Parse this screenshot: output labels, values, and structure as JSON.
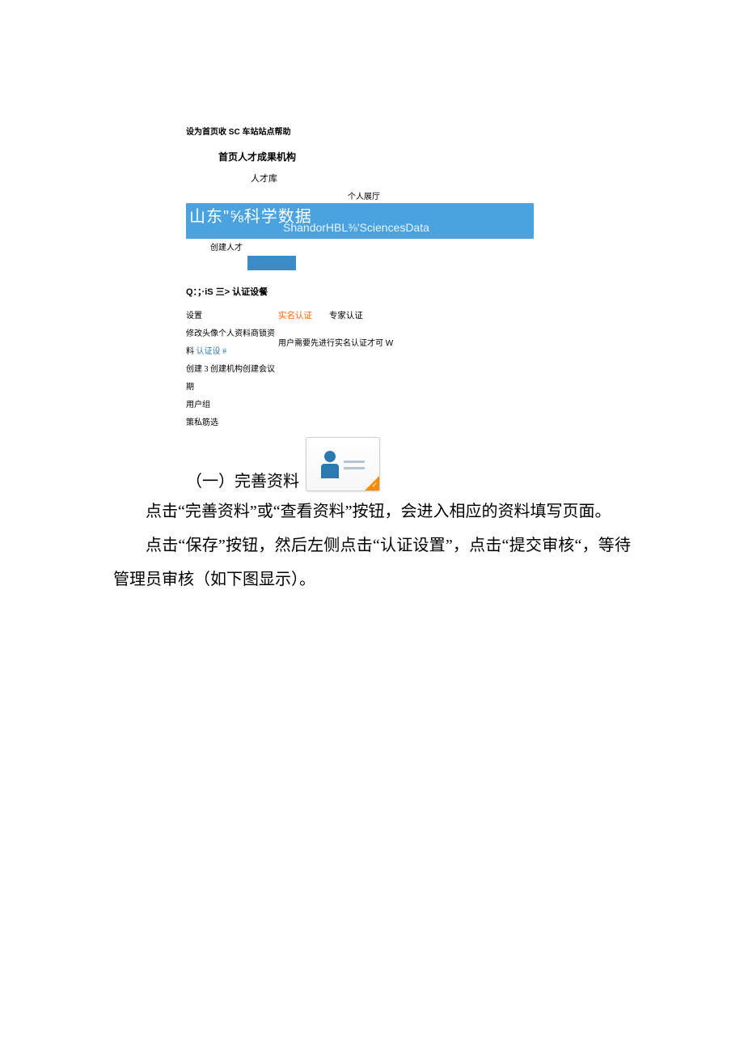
{
  "shot": {
    "top_links": "设为首页收 SC 车站站点帮助",
    "nav": "首页人才成果机构",
    "talent_pool": "人才库",
    "personal_hall": "个人展厅",
    "banner_cn": "山东\"⅝科学数据",
    "banner_en": "ShandorHBL⅜'SciencesData",
    "create_talent": "创建人才",
    "breadcrumb": "Q：；·iS 三> 认证设餐",
    "side": {
      "s1": "设置",
      "s2": "修改头像个人资料商锁资",
      "s3a": "料 ",
      "s3b": "认证设 #",
      "s4": "创建 3 创建机构创建会议期",
      "s5": "用户组",
      "s6": "策私筋选"
    },
    "tabs": {
      "active": "实名认证",
      "inactive": "专家认证"
    },
    "hint": "用户需要先进行实名认证才可 W"
  },
  "doc": {
    "heading": "（一）完善资料",
    "p1": "点击“完善资料”或“查看资料”按钮，会进入相应的资料填写页面。",
    "p2": "点击“保存”按钮，然后左侧点击“认证设置”，点击“提交审核“，等待管理员审核（如下图显示）。"
  }
}
